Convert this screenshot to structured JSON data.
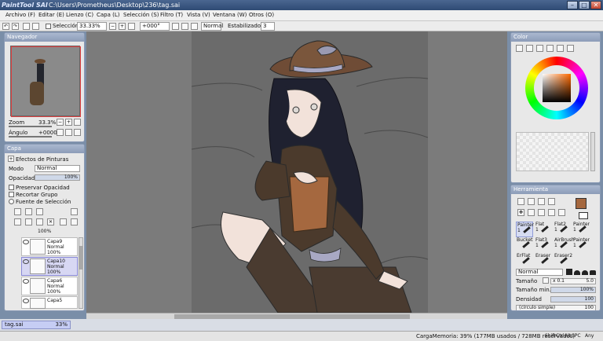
{
  "window": {
    "logo": "PaintTool SAI",
    "path": "C:\\Users\\Prometheus\\Desktop\\236\\tag.sai"
  },
  "menu": [
    {
      "label": "Archivo",
      "key": "(F)"
    },
    {
      "label": "Editar",
      "key": "(E)"
    },
    {
      "label": "Lienzo",
      "key": "(C)"
    },
    {
      "label": "Capa",
      "key": "(L)"
    },
    {
      "label": "Selección",
      "key": "(S)"
    },
    {
      "label": "Filtro",
      "key": "(T)"
    },
    {
      "label": "Vista",
      "key": "(V)"
    },
    {
      "label": "Ventana",
      "key": "(W)"
    },
    {
      "label": "Otros",
      "key": "(O)"
    }
  ],
  "toolbar": {
    "selection_label": "Selección",
    "zoom": "33.33%",
    "rotation": "+000°",
    "blend": "Normal",
    "stabilizer_label": "Estabilizador",
    "stabilizer_value": "3"
  },
  "navigator": {
    "title": "Navegador",
    "zoom_label": "Zoom",
    "zoom_value": "33.3%",
    "angle_label": "Ángulo",
    "angle_value": "+0000"
  },
  "layers": {
    "title": "Capa",
    "effects_label": "Efectos de Pinturas",
    "mode_label": "Modo",
    "mode_value": "Normal",
    "opacity_label": "Opacidad",
    "opacity_value": "100%",
    "opacity_fraction": 1.0,
    "preserve_opacity": "Preservar Opacidad",
    "clip_group": "Recortar Grupo",
    "selection_source": "Fuente de Selección",
    "top_opacity": "100%",
    "items": [
      {
        "name": "Capa9",
        "mode": "Normal",
        "opacity": "100%",
        "selected": false
      },
      {
        "name": "Capa10",
        "mode": "Normal",
        "opacity": "100%",
        "selected": true
      },
      {
        "name": "Capa6",
        "mode": "Normal",
        "opacity": "100%",
        "selected": false
      },
      {
        "name": "Capa5",
        "mode": "",
        "opacity": "",
        "selected": false
      }
    ]
  },
  "color": {
    "title": "Color",
    "current": "#a5683f",
    "secondary": "#ffffff"
  },
  "tools": {
    "title": "Herramienta",
    "brushes": [
      {
        "name": "Painter",
        "size": "1",
        "selected": true
      },
      {
        "name": "Flat",
        "size": "1",
        "selected": false
      },
      {
        "name": "Flat2",
        "size": "1",
        "selected": false
      },
      {
        "name": "Painter",
        "size": "1",
        "selected": false
      },
      {
        "name": "Bucket",
        "size": "",
        "selected": false
      },
      {
        "name": "Flat3",
        "size": "1",
        "selected": false
      },
      {
        "name": "AirBrush",
        "size": "1",
        "selected": false
      },
      {
        "name": "Painter",
        "size": "1",
        "selected": false
      },
      {
        "name": "ErFlat",
        "size": "",
        "selected": false
      },
      {
        "name": "Eraser",
        "size": "",
        "selected": false
      },
      {
        "name": "Eraser2",
        "size": "",
        "selected": false
      }
    ],
    "mode_value": "Normal",
    "size_label": "Tamaño",
    "size_mult": "x 0.1",
    "size_value": "5.0",
    "min_size_label": "Tamaño min.",
    "min_size_value": "100%",
    "density_label": "Densidad",
    "density_value": "100",
    "shape_value": "(círculo simple)",
    "shape_num": "100"
  },
  "document": {
    "tab_name": "tag.sai",
    "tab_zoom": "33%"
  },
  "status": {
    "memory": "CargaMemoria: 39% (177MB usados / 728MB reservados)",
    "keys": [
      "Shift",
      "Ctrl",
      "Alt",
      "SPC",
      "Any"
    ]
  }
}
